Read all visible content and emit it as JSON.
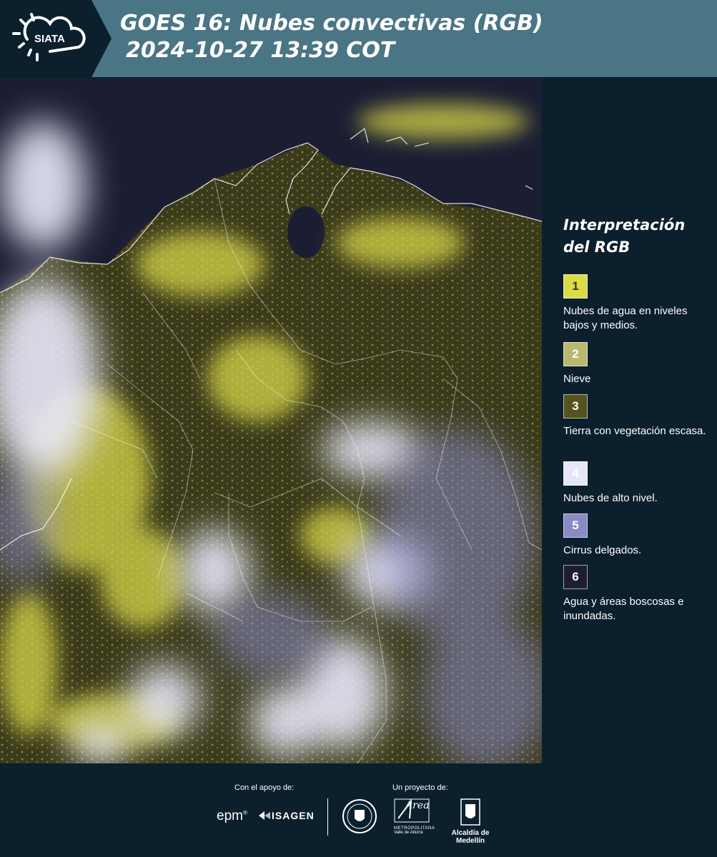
{
  "header": {
    "logo_text": "SIATA",
    "title_line1": "GOES 16: Nubes convectivas (RGB)",
    "title_line2": "2024-10-27 13:39 COT"
  },
  "legend": {
    "title_line1": "Interpretación",
    "title_line2": "del RGB",
    "items": [
      {
        "number": "1",
        "color": "#dcdc4a",
        "label": "Nubes de agua en niveles bajos y medios."
      },
      {
        "number": "2",
        "color": "#b9b96e",
        "label": "Nieve"
      },
      {
        "number": "3",
        "color": "#54521f",
        "label": "Tierra con vegetación escasa."
      },
      {
        "number": "4",
        "color": "#e6e6f6",
        "label": "Nubes de alto nivel."
      },
      {
        "number": "5",
        "color": "#8a8ac4",
        "label": "Cirrus delgados."
      },
      {
        "number": "6",
        "color": "#1e1e30",
        "label": "Agua y áreas boscosas e inundadas."
      }
    ]
  },
  "footer": {
    "support_label": "Con el apoyo de:",
    "project_label": "Un proyecto de:",
    "epm_text": "epm",
    "isagen_text": "ISAGEN",
    "area_text": "Área",
    "area_sub1": "METROPOLITANA",
    "area_sub2": "Valle de Aburrá",
    "alcaldia_text": "Alcaldía de Medellín"
  }
}
